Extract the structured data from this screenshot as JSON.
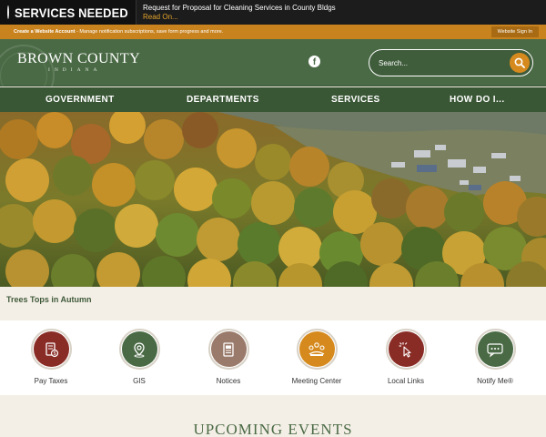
{
  "alert": {
    "badge_text": "SERVICES NEEDED",
    "headline": "Request for Proposal for Cleaning Services in County Bldgs",
    "read_on": "Read On..."
  },
  "account_bar": {
    "link_text": "Create a Website Account",
    "description": " - Manage notification subscriptions, save form progress and more.",
    "sign_in": "Website Sign In"
  },
  "header": {
    "logo_main": "BROWN COUNTY",
    "logo_sub": "INDIANA",
    "social_icon": "facebook-icon",
    "search_placeholder": "Search..."
  },
  "nav": {
    "items": [
      "GOVERNMENT",
      "DEPARTMENTS",
      "SERVICES",
      "HOW DO I..."
    ]
  },
  "hero": {
    "caption": "Trees Tops in Autumn"
  },
  "quick_links": [
    {
      "label": "Pay Taxes",
      "icon": "receipt-coin-icon",
      "color": "#8a2c26"
    },
    {
      "label": "GIS",
      "icon": "map-pin-icon",
      "color": "#4a6a45"
    },
    {
      "label": "Notices",
      "icon": "document-icon",
      "color": "#9a7a6a"
    },
    {
      "label": "Meeting Center",
      "icon": "meeting-people-icon",
      "color": "#d68a1e"
    },
    {
      "label": "Local Links",
      "icon": "cursor-click-icon",
      "color": "#8a2c26"
    },
    {
      "label": "Notify Me®",
      "icon": "chat-bubble-icon",
      "color": "#4a6a45"
    }
  ],
  "events": {
    "title": "UPCOMING EVENTS"
  },
  "colors": {
    "brand_green": "#4a6a45",
    "nav_green": "#395635",
    "accent_orange": "#c8831f",
    "alert_red": "#d8211a"
  }
}
